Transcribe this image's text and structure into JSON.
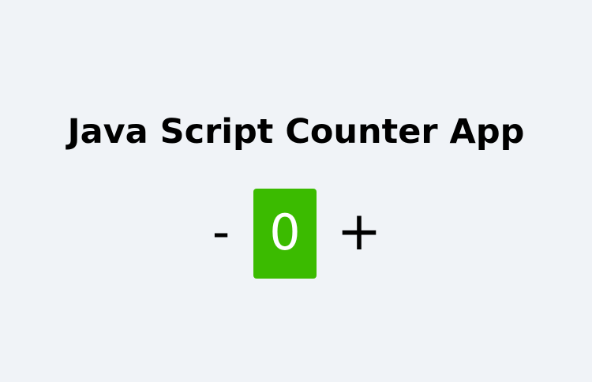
{
  "app": {
    "title": "Java Script Counter App"
  },
  "counter": {
    "decrement_label": "-",
    "value": "0",
    "increment_label": "+",
    "value_background": "#3bbb00",
    "value_color": "#ffffff"
  },
  "colors": {
    "page_background": "#f0f3f7",
    "text": "#000000"
  }
}
